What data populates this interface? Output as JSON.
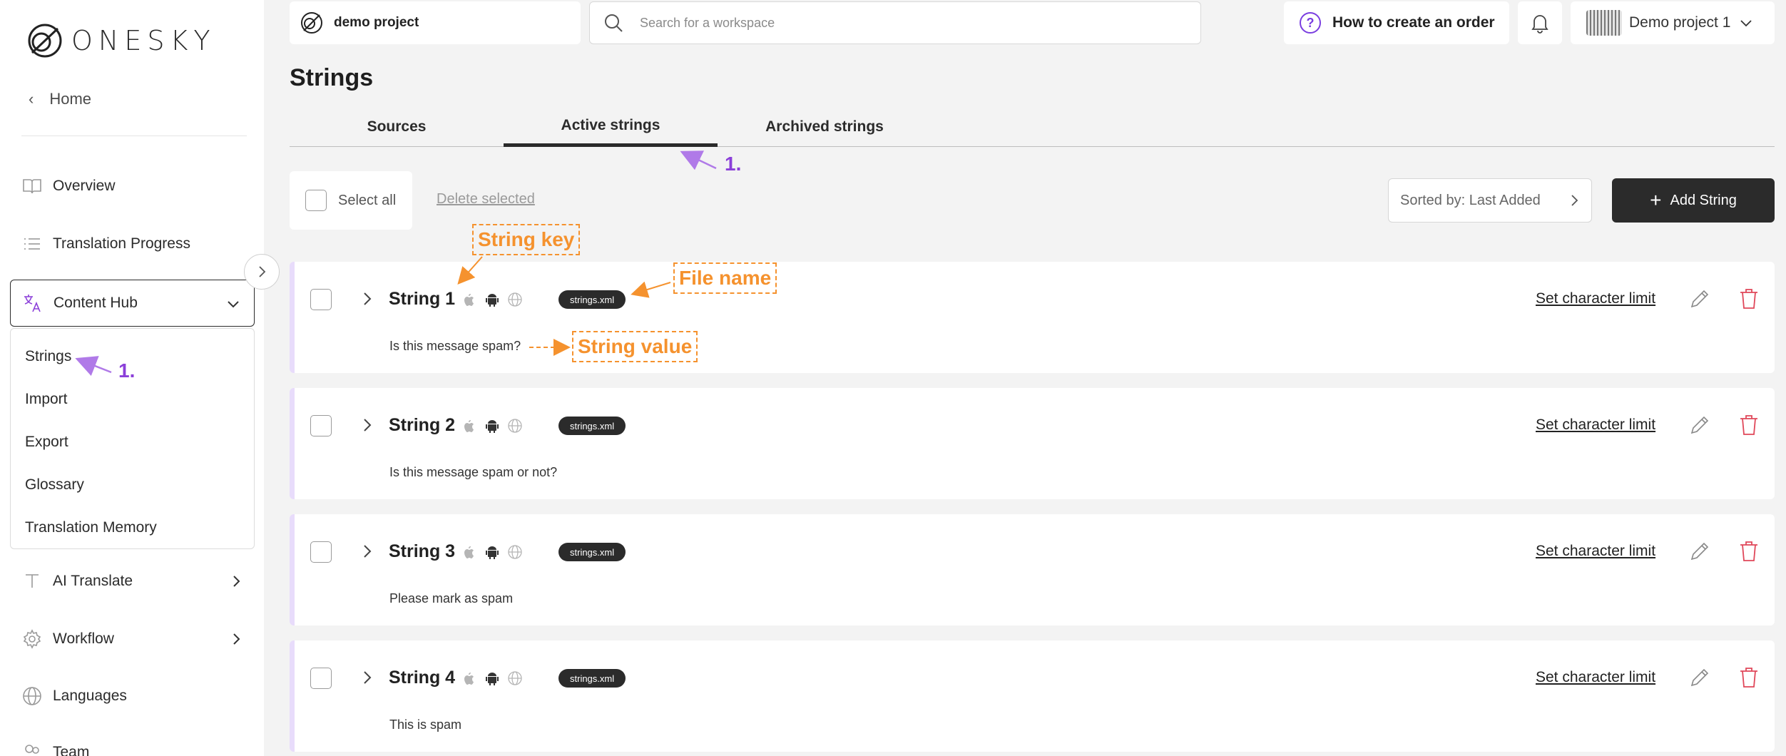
{
  "app": {
    "logo_text": "ONESKY",
    "project_name": "demo project",
    "search_placeholder": "Search for a workspace",
    "howto_label": "How to create an order",
    "account_name": "Demo project 1"
  },
  "sidebar": {
    "home_label": "Home",
    "items": [
      {
        "label": "Overview",
        "icon": "book-icon"
      },
      {
        "label": "Translation Progress",
        "icon": "list-icon"
      },
      {
        "label": "Content Hub",
        "icon": "translate-icon"
      },
      {
        "label": "AI Translate",
        "icon": "text-icon"
      },
      {
        "label": "Workflow",
        "icon": "gear-icon"
      },
      {
        "label": "Languages",
        "icon": "globe-icon"
      },
      {
        "label": "Team",
        "icon": "team-icon"
      }
    ],
    "submenu": [
      "Strings",
      "Import",
      "Export",
      "Glossary",
      "Translation Memory"
    ]
  },
  "page": {
    "title": "Strings",
    "tabs": [
      "Sources",
      "Active strings",
      "Archived strings"
    ],
    "active_tab": "Active strings"
  },
  "toolbar": {
    "select_all": "Select all",
    "delete_selected": "Delete selected",
    "sort_label": "Sorted by: Last Added",
    "add_string": "Add String"
  },
  "strings": [
    {
      "key": "String 1",
      "file": "strings.xml",
      "value": "Is this message spam?",
      "char_limit": "Set character limit"
    },
    {
      "key": "String 2",
      "file": "strings.xml",
      "value": "Is this message spam or not?",
      "char_limit": "Set character limit"
    },
    {
      "key": "String 3",
      "file": "strings.xml",
      "value": "Please mark as spam",
      "char_limit": "Set character limit"
    },
    {
      "key": "String 4",
      "file": "strings.xml",
      "value": "This is spam",
      "char_limit": "Set character limit"
    }
  ],
  "annotations": {
    "string_key": "String key",
    "file_name": "File name",
    "string_value": "String value",
    "step_tab": "1.",
    "step_menu": "1."
  },
  "colors": {
    "accent_purple": "#8b3fd9",
    "annotation_orange": "#f5922e",
    "card_stripe": "#e8dcfb",
    "primary_dark": "#2b2b2b",
    "delete_red": "#e0485a"
  }
}
